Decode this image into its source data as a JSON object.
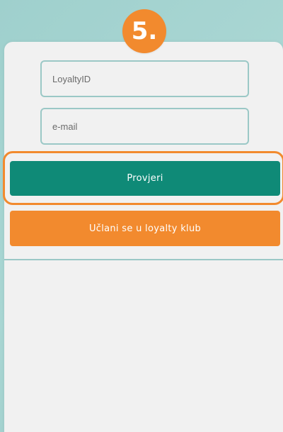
{
  "step_badge": "5.",
  "form": {
    "loyalty_id_placeholder": "LoyaltyID",
    "email_placeholder": "e-mail",
    "check_button_label": "Provjeri",
    "join_button_label": "Učlani se u loyalty klub"
  },
  "colors": {
    "accent_orange": "#f28a2e",
    "button_teal": "#0f8a77",
    "field_border": "#9bc8c6",
    "card_background": "#f1f1f1"
  }
}
